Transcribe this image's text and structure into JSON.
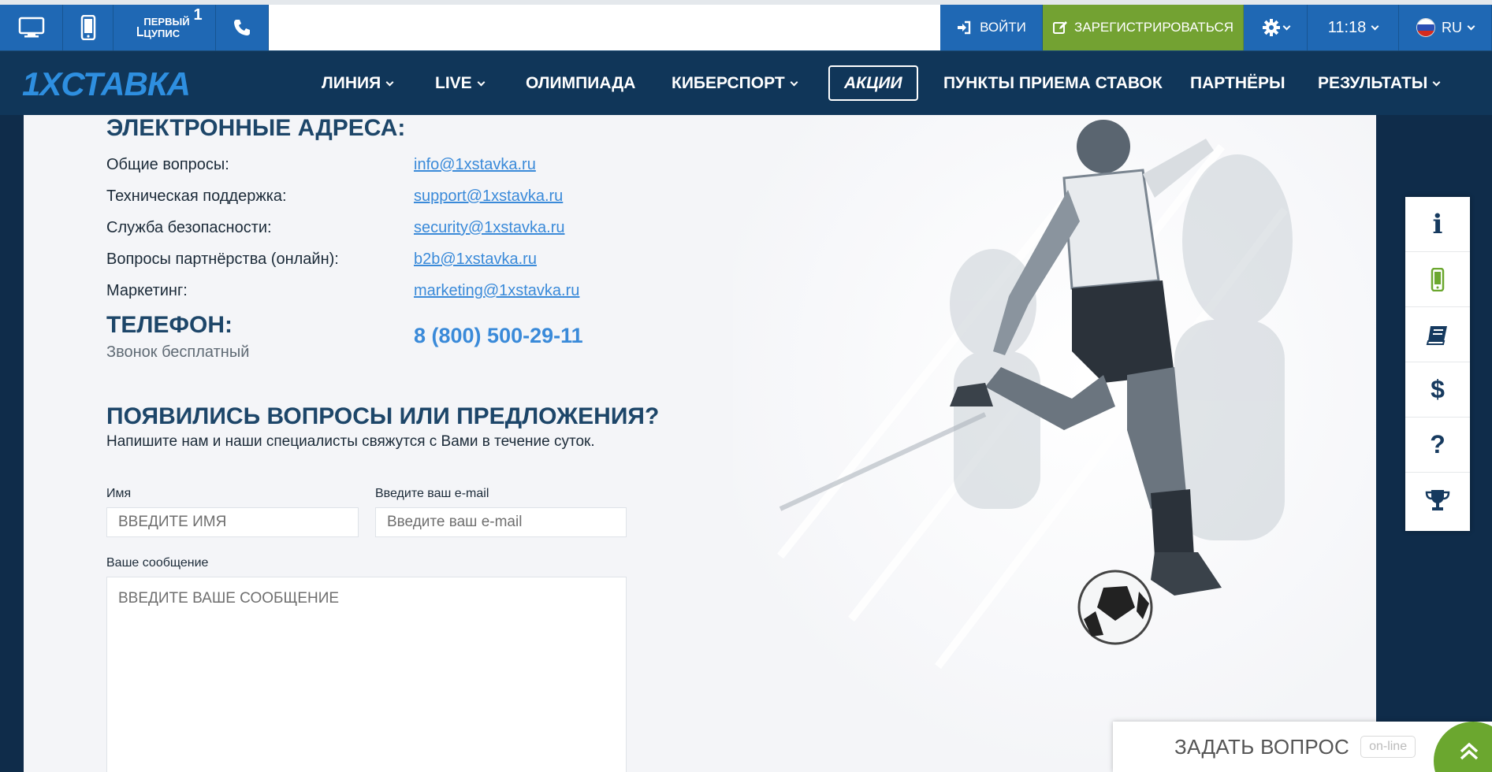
{
  "topbar": {
    "cupis_line1": "ПЕРВЫЙ",
    "cupis_line2": "ЦУПИС",
    "cupis_sup": "1",
    "login_label": "ВОЙТИ",
    "register_label": "ЗАРЕГИСТРИРОВАТЬСЯ",
    "time": "11:18",
    "lang": "RU"
  },
  "nav": {
    "logo": "1XСТАВКА",
    "items": [
      {
        "label": "ЛИНИЯ"
      },
      {
        "label": "LIVE"
      },
      {
        "label": "ОЛИМПИАДА"
      },
      {
        "label": "КИБЕРСПОРТ"
      },
      {
        "label": "АКЦИИ"
      },
      {
        "label": "ПУНКТЫ ПРИЕМА СТАВОК"
      },
      {
        "label": "ПАРТНЁРЫ"
      },
      {
        "label": "РЕЗУЛЬТАТЫ"
      }
    ]
  },
  "contacts": {
    "emails_heading": "ЭЛЕКТРОННЫЕ АДРЕСА:",
    "rows": [
      {
        "label": "Общие вопросы:",
        "email": "info@1xstavka.ru"
      },
      {
        "label": "Техническая поддержка:",
        "email": "support@1xstavka.ru"
      },
      {
        "label": "Служба безопасности:",
        "email": "security@1xstavka.ru"
      },
      {
        "label": "Вопросы партнёрства (онлайн):",
        "email": "b2b@1xstavka.ru"
      },
      {
        "label": "Маркетинг:",
        "email": "marketing@1xstavka.ru"
      }
    ],
    "phone_heading": "ТЕЛЕФОН:",
    "phone_note": "Звонок бесплатный",
    "phone_number": "8 (800) 500-29-11"
  },
  "feedback": {
    "heading": "ПОЯВИЛИСЬ ВОПРОСЫ ИЛИ ПРЕДЛОЖЕНИЯ?",
    "subheading": "Напишите нам и наши специалисты свяжутся с Вами в течение суток.",
    "name_label": "Имя",
    "name_placeholder": "ВВЕДИТЕ ИМЯ",
    "email_label": "Введите ваш e-mail",
    "email_placeholder": "Введите ваш e-mail",
    "message_label": "Ваше сообщение",
    "message_placeholder": "ВВЕДИТЕ ВАШЕ СООБЩЕНИЕ"
  },
  "side_tools": [
    "info-icon",
    "mobile-icon",
    "book-icon",
    "dollar-icon",
    "question-icon",
    "trophy-icon"
  ],
  "ask_widget": {
    "label": "ЗАДАТЬ ВОПРОС",
    "badge": "on-line"
  },
  "colors": {
    "nav_bg": "#103659",
    "topbar_blue": "#1f68b4",
    "register_green": "#73a232",
    "heading": "#1d4669",
    "link": "#3a8ad9"
  }
}
